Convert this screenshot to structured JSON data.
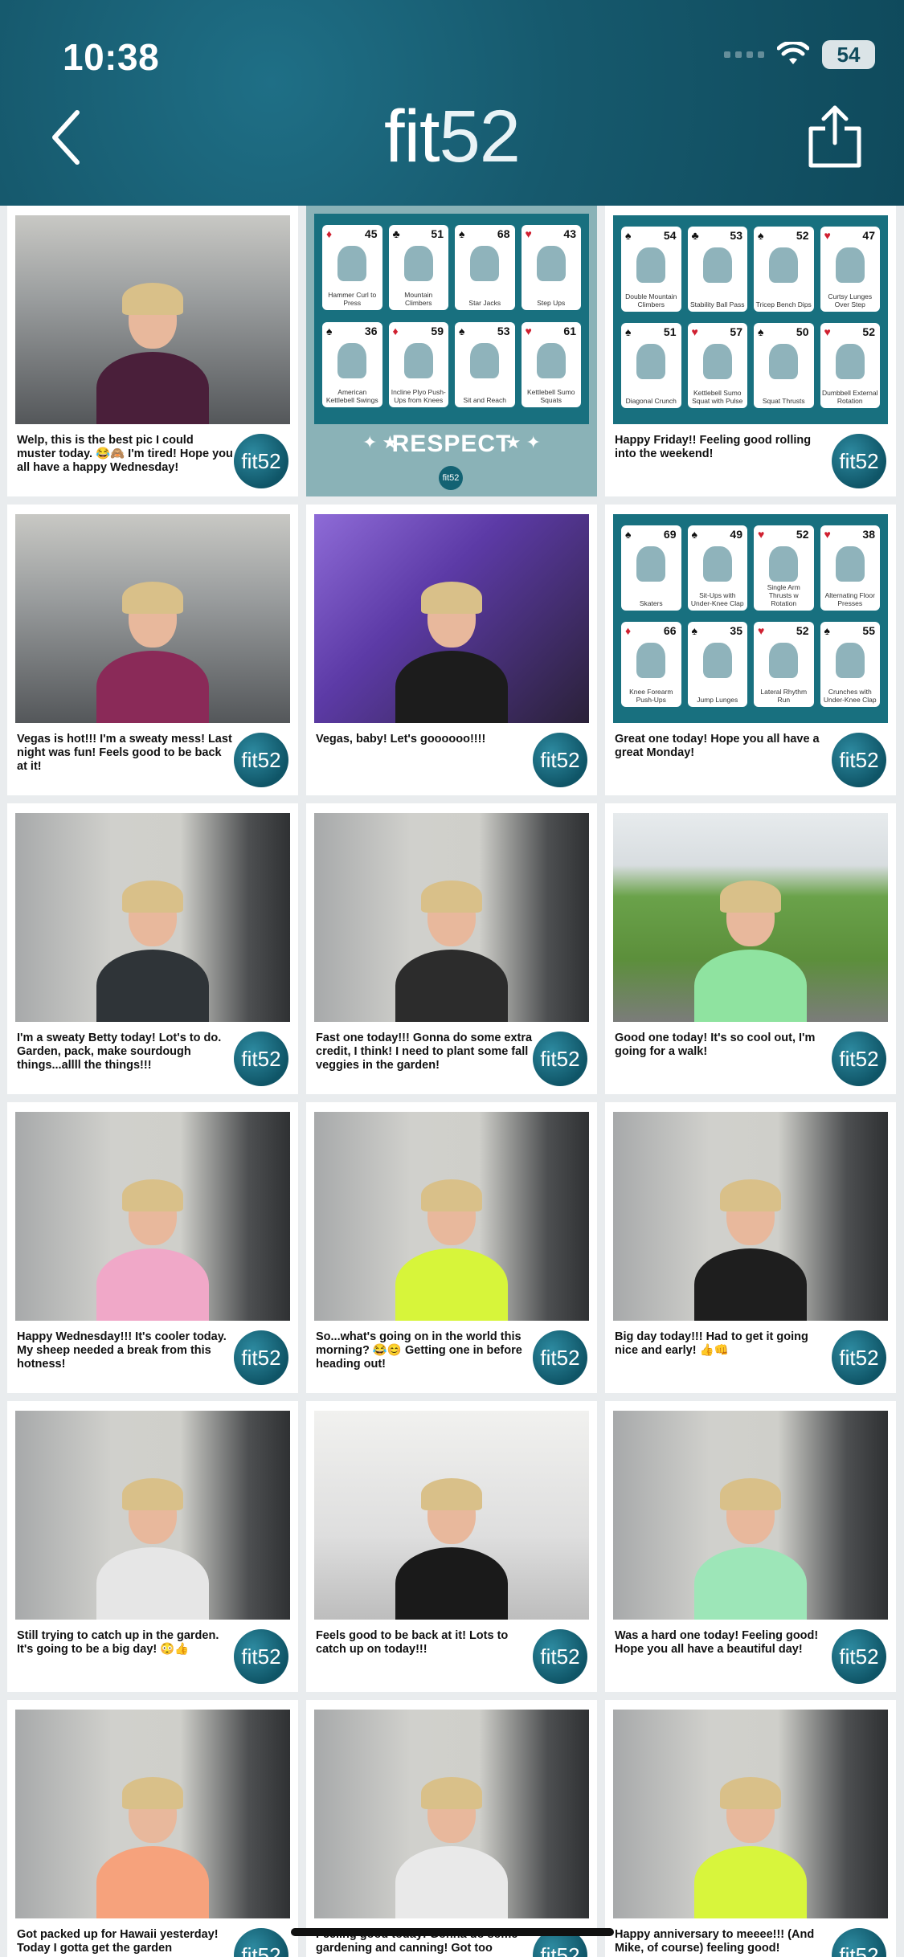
{
  "status_bar": {
    "time": "10:38",
    "battery": "54"
  },
  "header": {
    "logo_fit": "fit",
    "logo_num": "52"
  },
  "badge_text": "fit52",
  "respect_card": {
    "text": "RESPECT",
    "badge": "fit52"
  },
  "posts": [
    {
      "type": "photo",
      "photo": "gym",
      "top": "#4a1f3a",
      "caption": "Welp, this is the best pic I could muster today. 😂🙈 I'm tired! Hope you all have a happy Wednesday!"
    },
    {
      "type": "respect"
    },
    {
      "type": "workout",
      "caption": "Happy Friday!! Feeling good rolling into the weekend!"
    },
    {
      "type": "photo",
      "photo": "gym",
      "top": "#8a2a58",
      "caption": "Vegas is hot!!! I'm a sweaty mess! Last night was fun! Feels good to be back at it!"
    },
    {
      "type": "photo",
      "photo": "purple",
      "top": "#1c1c1c",
      "caption": "Vegas, baby! Let's goooooo!!!!"
    },
    {
      "type": "workout",
      "caption": "Great one today! Hope you all have a great Monday!"
    },
    {
      "type": "photo",
      "photo": "gym2",
      "top": "#2f3438",
      "caption": "I'm a sweaty Betty today! Lot's to do. Garden, pack, make sourdough things...allll the things!!!"
    },
    {
      "type": "photo",
      "photo": "gym2",
      "top": "#2c2c2c",
      "caption": "Fast one today!!! Gonna do some extra credit, I think! I need to plant some fall veggies in the garden!"
    },
    {
      "type": "photo",
      "photo": "outdoor",
      "top": "#8fe3a0",
      "caption": "Good one today! It's so cool out, I'm going for a walk!"
    },
    {
      "type": "photo",
      "photo": "gym2",
      "top": "#f0a8c8",
      "caption": "Happy Wednesday!!! It's cooler today. My sheep needed a break from this hotness!"
    },
    {
      "type": "photo",
      "photo": "gym2",
      "top": "#d7f53a",
      "caption": "So...what's going on in the world this morning? 😂😊 Getting one in before heading out!"
    },
    {
      "type": "photo",
      "photo": "gym2",
      "top": "#1e1e1e",
      "caption": "Big day today!!! Had to get it going nice and early! 👍👊"
    },
    {
      "type": "photo",
      "photo": "gym2",
      "top": "#e6e6e6",
      "caption": "Still trying to catch up in the garden. It's going to be a big day! 😳👍"
    },
    {
      "type": "photo",
      "photo": "white",
      "top": "#1a1a1a",
      "caption": "Feels good to be back at it! Lots to catch up on today!!!"
    },
    {
      "type": "photo",
      "photo": "gym2",
      "top": "#9de6b8",
      "caption": "Was a hard one today! Feeling good! Hope you all have a beautiful day!"
    },
    {
      "type": "photo",
      "photo": "gym2",
      "top": "#f6a27c",
      "caption": "Got packed up for Hawaii yesterday! Today I gotta get the garden"
    },
    {
      "type": "photo",
      "photo": "gym2",
      "top": "#e9e9e9",
      "caption": "Feeling good today! Gonna do some gardening and canning! Got too"
    },
    {
      "type": "photo",
      "photo": "gym2",
      "top": "#d8f53c",
      "caption": "Happy anniversary to meeee!!! (And Mike, of course) feeling good!"
    }
  ],
  "workout_sets": [
    [
      {
        "suit": "♦",
        "num": "45",
        "ex": "Hammer Curl to Press"
      },
      {
        "suit": "♣",
        "num": "51",
        "ex": "Mountain Climbers"
      },
      {
        "suit": "♠",
        "num": "68",
        "ex": "Star Jacks"
      },
      {
        "suit": "♥",
        "num": "43",
        "ex": "Step Ups"
      },
      {
        "suit": "♠",
        "num": "36",
        "ex": "American Kettlebell Swings"
      },
      {
        "suit": "♦",
        "num": "59",
        "ex": "Incline Plyo Push-Ups from Knees"
      },
      {
        "suit": "♠",
        "num": "53",
        "ex": "Sit and Reach"
      },
      {
        "suit": "♥",
        "num": "61",
        "ex": "Kettlebell Sumo Squats"
      }
    ],
    [
      {
        "suit": "♠",
        "num": "54",
        "ex": "Double Mountain Climbers"
      },
      {
        "suit": "♣",
        "num": "53",
        "ex": "Stability Ball Pass"
      },
      {
        "suit": "♠",
        "num": "52",
        "ex": "Tricep Bench Dips"
      },
      {
        "suit": "♥",
        "num": "47",
        "ex": "Curtsy Lunges Over Step"
      },
      {
        "suit": "♠",
        "num": "51",
        "ex": "Diagonal Crunch"
      },
      {
        "suit": "♥",
        "num": "57",
        "ex": "Kettlebell Sumo Squat with Pulse"
      },
      {
        "suit": "♠",
        "num": "50",
        "ex": "Squat Thrusts"
      },
      {
        "suit": "♥",
        "num": "52",
        "ex": "Dumbbell External Rotation"
      }
    ],
    [
      {
        "suit": "♠",
        "num": "69",
        "ex": "Skaters"
      },
      {
        "suit": "♠",
        "num": "49",
        "ex": "Sit-Ups with Under-Knee Clap"
      },
      {
        "suit": "♥",
        "num": "52",
        "ex": "Single Arm Thrusts w Rotation"
      },
      {
        "suit": "♥",
        "num": "38",
        "ex": "Alternating Floor Presses"
      },
      {
        "suit": "♦",
        "num": "66",
        "ex": "Knee Forearm Push-Ups"
      },
      {
        "suit": "♠",
        "num": "35",
        "ex": "Jump Lunges"
      },
      {
        "suit": "♥",
        "num": "52",
        "ex": "Lateral Rhythm Run"
      },
      {
        "suit": "♠",
        "num": "55",
        "ex": "Crunches with Under-Knee Clap"
      }
    ]
  ]
}
